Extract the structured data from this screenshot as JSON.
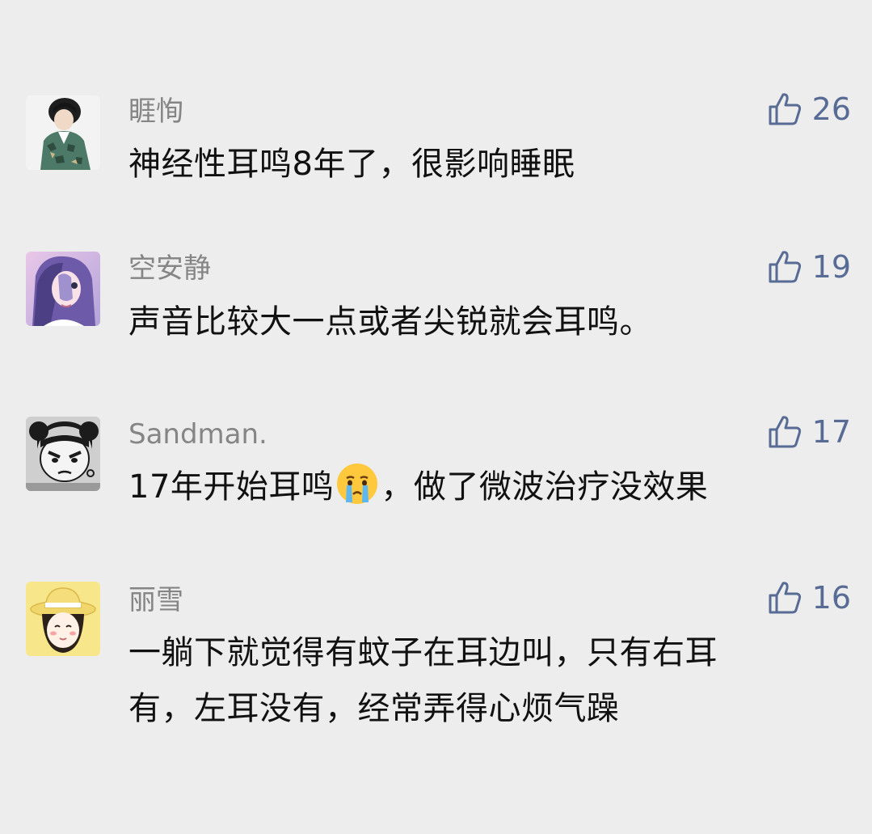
{
  "colors": {
    "background": "#ededed",
    "username": "#858585",
    "text": "#111111",
    "like_accent": "#576b95"
  },
  "comments": [
    {
      "username": "睚恂",
      "text": "神经性耳鸣8年了，很影响睡眠",
      "likes": "26",
      "avatar": "avatar-boy-camo-jacket"
    },
    {
      "username": "空安静",
      "text": "声音比较大一点或者尖锐就会耳鸣。",
      "likes": "19",
      "avatar": "avatar-girl-purple-hair"
    },
    {
      "username": "Sandman.",
      "text_before_emoji": "17年开始耳鸣",
      "emoji": "crying-face-emoji",
      "text_after_emoji": "，做了微波治疗没效果",
      "likes": "17",
      "avatar": "avatar-cartoon-bun-hair"
    },
    {
      "username": "丽雪",
      "text_line1": "一躺下就觉得有蚊子在耳边叫，只有右耳",
      "text_line2": "有，左耳没有，经常弄得心烦气躁",
      "likes": "16",
      "avatar": "avatar-girl-straw-hat"
    }
  ],
  "like_icon": "thumbs-up-outline-icon"
}
